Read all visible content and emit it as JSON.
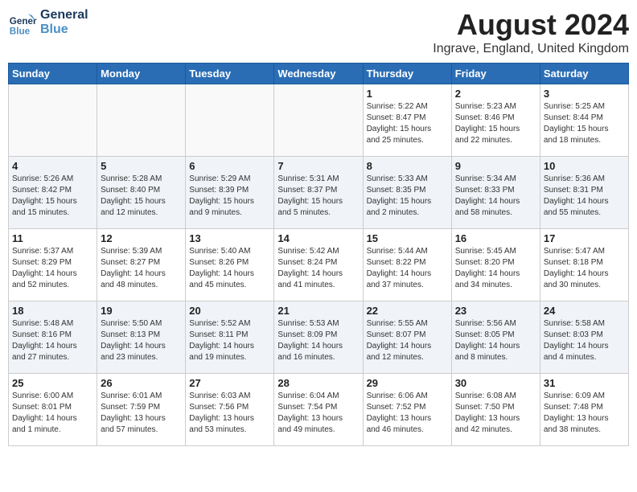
{
  "logo": {
    "line1": "General",
    "line2": "Blue"
  },
  "title": {
    "month_year": "August 2024",
    "location": "Ingrave, England, United Kingdom"
  },
  "days_of_week": [
    "Sunday",
    "Monday",
    "Tuesday",
    "Wednesday",
    "Thursday",
    "Friday",
    "Saturday"
  ],
  "weeks": [
    [
      {
        "day": "",
        "info": ""
      },
      {
        "day": "",
        "info": ""
      },
      {
        "day": "",
        "info": ""
      },
      {
        "day": "",
        "info": ""
      },
      {
        "day": "1",
        "info": "Sunrise: 5:22 AM\nSunset: 8:47 PM\nDaylight: 15 hours\nand 25 minutes."
      },
      {
        "day": "2",
        "info": "Sunrise: 5:23 AM\nSunset: 8:46 PM\nDaylight: 15 hours\nand 22 minutes."
      },
      {
        "day": "3",
        "info": "Sunrise: 5:25 AM\nSunset: 8:44 PM\nDaylight: 15 hours\nand 18 minutes."
      }
    ],
    [
      {
        "day": "4",
        "info": "Sunrise: 5:26 AM\nSunset: 8:42 PM\nDaylight: 15 hours\nand 15 minutes."
      },
      {
        "day": "5",
        "info": "Sunrise: 5:28 AM\nSunset: 8:40 PM\nDaylight: 15 hours\nand 12 minutes."
      },
      {
        "day": "6",
        "info": "Sunrise: 5:29 AM\nSunset: 8:39 PM\nDaylight: 15 hours\nand 9 minutes."
      },
      {
        "day": "7",
        "info": "Sunrise: 5:31 AM\nSunset: 8:37 PM\nDaylight: 15 hours\nand 5 minutes."
      },
      {
        "day": "8",
        "info": "Sunrise: 5:33 AM\nSunset: 8:35 PM\nDaylight: 15 hours\nand 2 minutes."
      },
      {
        "day": "9",
        "info": "Sunrise: 5:34 AM\nSunset: 8:33 PM\nDaylight: 14 hours\nand 58 minutes."
      },
      {
        "day": "10",
        "info": "Sunrise: 5:36 AM\nSunset: 8:31 PM\nDaylight: 14 hours\nand 55 minutes."
      }
    ],
    [
      {
        "day": "11",
        "info": "Sunrise: 5:37 AM\nSunset: 8:29 PM\nDaylight: 14 hours\nand 52 minutes."
      },
      {
        "day": "12",
        "info": "Sunrise: 5:39 AM\nSunset: 8:27 PM\nDaylight: 14 hours\nand 48 minutes."
      },
      {
        "day": "13",
        "info": "Sunrise: 5:40 AM\nSunset: 8:26 PM\nDaylight: 14 hours\nand 45 minutes."
      },
      {
        "day": "14",
        "info": "Sunrise: 5:42 AM\nSunset: 8:24 PM\nDaylight: 14 hours\nand 41 minutes."
      },
      {
        "day": "15",
        "info": "Sunrise: 5:44 AM\nSunset: 8:22 PM\nDaylight: 14 hours\nand 37 minutes."
      },
      {
        "day": "16",
        "info": "Sunrise: 5:45 AM\nSunset: 8:20 PM\nDaylight: 14 hours\nand 34 minutes."
      },
      {
        "day": "17",
        "info": "Sunrise: 5:47 AM\nSunset: 8:18 PM\nDaylight: 14 hours\nand 30 minutes."
      }
    ],
    [
      {
        "day": "18",
        "info": "Sunrise: 5:48 AM\nSunset: 8:16 PM\nDaylight: 14 hours\nand 27 minutes."
      },
      {
        "day": "19",
        "info": "Sunrise: 5:50 AM\nSunset: 8:13 PM\nDaylight: 14 hours\nand 23 minutes."
      },
      {
        "day": "20",
        "info": "Sunrise: 5:52 AM\nSunset: 8:11 PM\nDaylight: 14 hours\nand 19 minutes."
      },
      {
        "day": "21",
        "info": "Sunrise: 5:53 AM\nSunset: 8:09 PM\nDaylight: 14 hours\nand 16 minutes."
      },
      {
        "day": "22",
        "info": "Sunrise: 5:55 AM\nSunset: 8:07 PM\nDaylight: 14 hours\nand 12 minutes."
      },
      {
        "day": "23",
        "info": "Sunrise: 5:56 AM\nSunset: 8:05 PM\nDaylight: 14 hours\nand 8 minutes."
      },
      {
        "day": "24",
        "info": "Sunrise: 5:58 AM\nSunset: 8:03 PM\nDaylight: 14 hours\nand 4 minutes."
      }
    ],
    [
      {
        "day": "25",
        "info": "Sunrise: 6:00 AM\nSunset: 8:01 PM\nDaylight: 14 hours\nand 1 minute."
      },
      {
        "day": "26",
        "info": "Sunrise: 6:01 AM\nSunset: 7:59 PM\nDaylight: 13 hours\nand 57 minutes."
      },
      {
        "day": "27",
        "info": "Sunrise: 6:03 AM\nSunset: 7:56 PM\nDaylight: 13 hours\nand 53 minutes."
      },
      {
        "day": "28",
        "info": "Sunrise: 6:04 AM\nSunset: 7:54 PM\nDaylight: 13 hours\nand 49 minutes."
      },
      {
        "day": "29",
        "info": "Sunrise: 6:06 AM\nSunset: 7:52 PM\nDaylight: 13 hours\nand 46 minutes."
      },
      {
        "day": "30",
        "info": "Sunrise: 6:08 AM\nSunset: 7:50 PM\nDaylight: 13 hours\nand 42 minutes."
      },
      {
        "day": "31",
        "info": "Sunrise: 6:09 AM\nSunset: 7:48 PM\nDaylight: 13 hours\nand 38 minutes."
      }
    ]
  ]
}
